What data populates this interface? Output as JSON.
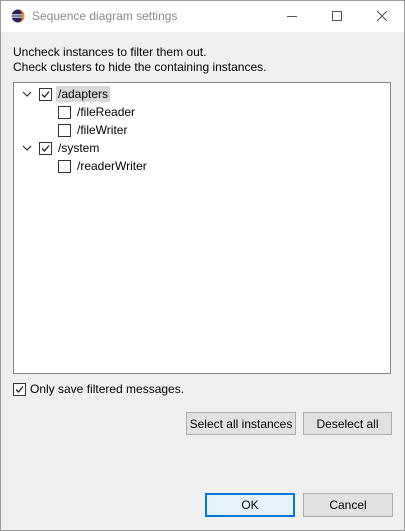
{
  "window": {
    "title": "Sequence diagram settings"
  },
  "instructions": {
    "line1": "Uncheck instances to filter them out.",
    "line2": "Check clusters to hide the containing instances."
  },
  "tree": {
    "nodes": [
      {
        "label": "/adapters",
        "checked": true,
        "expanded": true,
        "selected": true
      },
      {
        "label": "/fileReader",
        "checked": false
      },
      {
        "label": "/fileWriter",
        "checked": false
      },
      {
        "label": "/system",
        "checked": true,
        "expanded": true,
        "selected": false
      },
      {
        "label": "/readerWriter",
        "checked": false
      }
    ]
  },
  "options": {
    "save_filtered_label": "Only save filtered messages.",
    "save_filtered_checked": true
  },
  "buttons": {
    "select_all": "Select all instances",
    "deselect_all": "Deselect all",
    "ok": "OK",
    "cancel": "Cancel"
  },
  "icons": {
    "app": "eclipse-icon",
    "minimize": "minimize-icon",
    "maximize": "maximize-icon",
    "close": "close-icon",
    "expander": "chevron-down-icon",
    "check": "checkmark-icon"
  },
  "colors": {
    "accent": "#0078d7",
    "title_text": "#8a8a8a",
    "selection": "#d9d9d9",
    "dialog_bg": "#f0f0f0"
  }
}
